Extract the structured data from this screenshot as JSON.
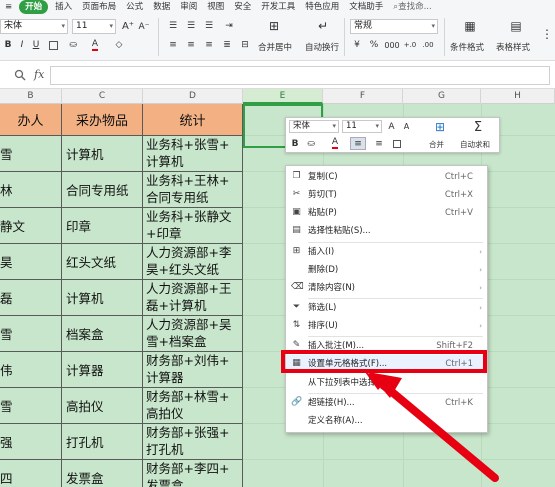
{
  "menubar": {
    "items": [
      {
        "label": "开始",
        "active": true
      },
      {
        "label": "插入"
      },
      {
        "label": "页面布局"
      },
      {
        "label": "公式"
      },
      {
        "label": "数据"
      },
      {
        "label": "审阅"
      },
      {
        "label": "视图"
      },
      {
        "label": "安全"
      },
      {
        "label": "开发工具"
      },
      {
        "label": "特色应用"
      },
      {
        "label": "文档助手"
      },
      {
        "label": "查找命..."
      }
    ],
    "accent": "#2f9e44"
  },
  "ribbon": {
    "font_name": "宋体",
    "font_size": "11",
    "increase_font": "A⁺",
    "decrease_font": "A⁻",
    "bold": "B",
    "italic": "I",
    "underline": "U",
    "merge_center": "合并居中",
    "wrap_text": "自动换行",
    "number_format": "常规",
    "conditional_format": "条件格式",
    "table_style": "表格样式",
    "font_color": "#e60012"
  },
  "formula_bar": {
    "fx_label": "fx",
    "value": ""
  },
  "columns": [
    {
      "label": "B"
    },
    {
      "label": "C"
    },
    {
      "label": "D"
    },
    {
      "label": "E",
      "selected": true
    },
    {
      "label": "F"
    },
    {
      "label": "G"
    },
    {
      "label": "H"
    }
  ],
  "table": {
    "headers": [
      "办人",
      "采办物品",
      "统计"
    ],
    "rows": [
      [
        "雪",
        "计算机",
        "业务科+张雪+计算机"
      ],
      [
        "林",
        "合同专用纸",
        "业务科+王林+合同专用纸"
      ],
      [
        "静文",
        "印章",
        "业务科+张静文+印章"
      ],
      [
        "昊",
        "红头文纸",
        "人力资源部+李昊+红头文纸"
      ],
      [
        "磊",
        "计算机",
        "人力资源部+王磊+计算机"
      ],
      [
        "雪",
        "档案盒",
        "人力资源部+吴雪+档案盒"
      ],
      [
        "伟",
        "计算器",
        "财务部+刘伟+计算器"
      ],
      [
        "雪",
        "高拍仪",
        "财务部+林雪+高拍仪"
      ],
      [
        "强",
        "打孔机",
        "财务部+张强+打孔机"
      ],
      [
        "四",
        "发票盒",
        "财务部+李四+发票盒"
      ]
    ],
    "rows_display": [
      [
        "业务科+张雪+",
        "计算机"
      ],
      [
        "业务科+王林+",
        "合同专用纸"
      ],
      [
        "业务科+张静文",
        "+印章"
      ],
      [
        "人力资源部+李",
        "昊+红头文纸"
      ],
      [
        "人力资源部+王",
        "磊+计算机"
      ],
      [
        "人力资源部+吴",
        "雪+档案盒"
      ],
      [
        "财务部+刘伟+",
        "计算器"
      ],
      [
        "财务部+林雪+",
        "高拍仪"
      ],
      [
        "财务部+张强+",
        "打孔机"
      ],
      [
        "财务部+李四+",
        "发票盒"
      ]
    ],
    "header_color": "#f3b183",
    "cell_color": "#c8e6cb"
  },
  "mini_toolbar": {
    "font_name": "宋体",
    "font_size": "11",
    "merge_label": "合并",
    "autosum_label": "自动求和"
  },
  "context_menu": {
    "items": [
      {
        "icon": "copy-icon",
        "label": "复制(C)",
        "shortcut": "Ctrl+C"
      },
      {
        "icon": "cut-icon",
        "label": "剪切(T)",
        "shortcut": "Ctrl+X"
      },
      {
        "icon": "paste-icon",
        "label": "粘贴(P)",
        "shortcut": "Ctrl+V"
      },
      {
        "icon": "paste-special-icon",
        "label": "选择性粘贴(S)..."
      },
      {
        "icon": "insert-icon",
        "label": "插入(I)",
        "submenu": true
      },
      {
        "icon": "none",
        "label": "删除(D)",
        "submenu": true
      },
      {
        "icon": "clear-icon",
        "label": "清除内容(N)",
        "submenu": true
      },
      {
        "icon": "filter-icon",
        "label": "筛选(L)",
        "submenu": true
      },
      {
        "icon": "sort-icon",
        "label": "排序(U)",
        "submenu": true
      },
      {
        "icon": "comment-icon",
        "label": "插入批注(M)...",
        "shortcut": "Shift+F2"
      },
      {
        "icon": "format-cells-icon",
        "label": "设置单元格格式(F)...",
        "shortcut": "Ctrl+1",
        "highlighted": true
      },
      {
        "icon": "none",
        "label": "从下拉列表中选择..."
      },
      {
        "icon": "link-icon",
        "label": "超链接(H)...",
        "shortcut": "Ctrl+K"
      },
      {
        "icon": "none",
        "label": "定义名称(A)..."
      }
    ],
    "highlight_color": "#e60012"
  }
}
